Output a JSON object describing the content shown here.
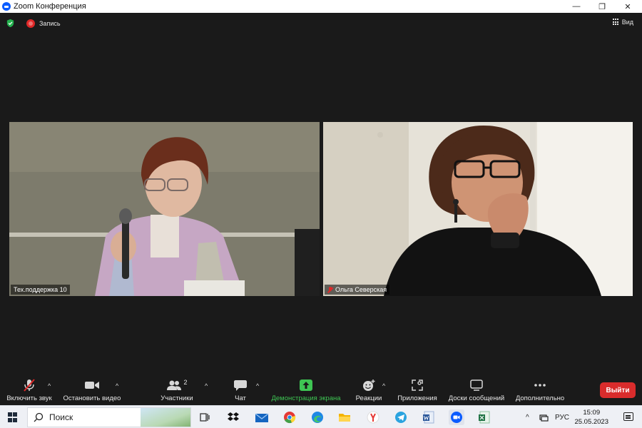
{
  "window": {
    "title": "Zoom Конференция",
    "minimize_glyph": "—",
    "restore_glyph": "❐",
    "close_glyph": "✕"
  },
  "meeting": {
    "recording_label": "Запись",
    "view_label": "Вид",
    "participants": [
      {
        "name": "Тех.поддержка 10",
        "muted": false
      },
      {
        "name": "Ольга Северская",
        "muted": true
      }
    ]
  },
  "toolbar": {
    "unmute_label": "Включить звук",
    "stop_video_label": "Остановить видео",
    "participants_label": "Участники",
    "participants_count": "2",
    "chat_label": "Чат",
    "share_label": "Демонстрация экрана",
    "reactions_label": "Реакции",
    "apps_label": "Приложения",
    "whiteboards_label": "Доски сообщений",
    "more_label": "Дополнительно",
    "leave_label": "Выйти",
    "caret_glyph": "^"
  },
  "taskbar": {
    "search_label": "Поиск",
    "apps": [
      "task-view",
      "dropbox",
      "mail",
      "chrome",
      "edge",
      "file-explorer",
      "yandex",
      "telegram",
      "word",
      "zoom",
      "excel"
    ],
    "tray_chevron": "^",
    "language": "РУС",
    "time": "15:09",
    "date": "25.05.2023"
  },
  "colors": {
    "meeting_bg": "#1a1a1a",
    "share_green": "#3ec553",
    "leave_red": "#d92c2c",
    "zoom_blue": "#0b5cff"
  }
}
